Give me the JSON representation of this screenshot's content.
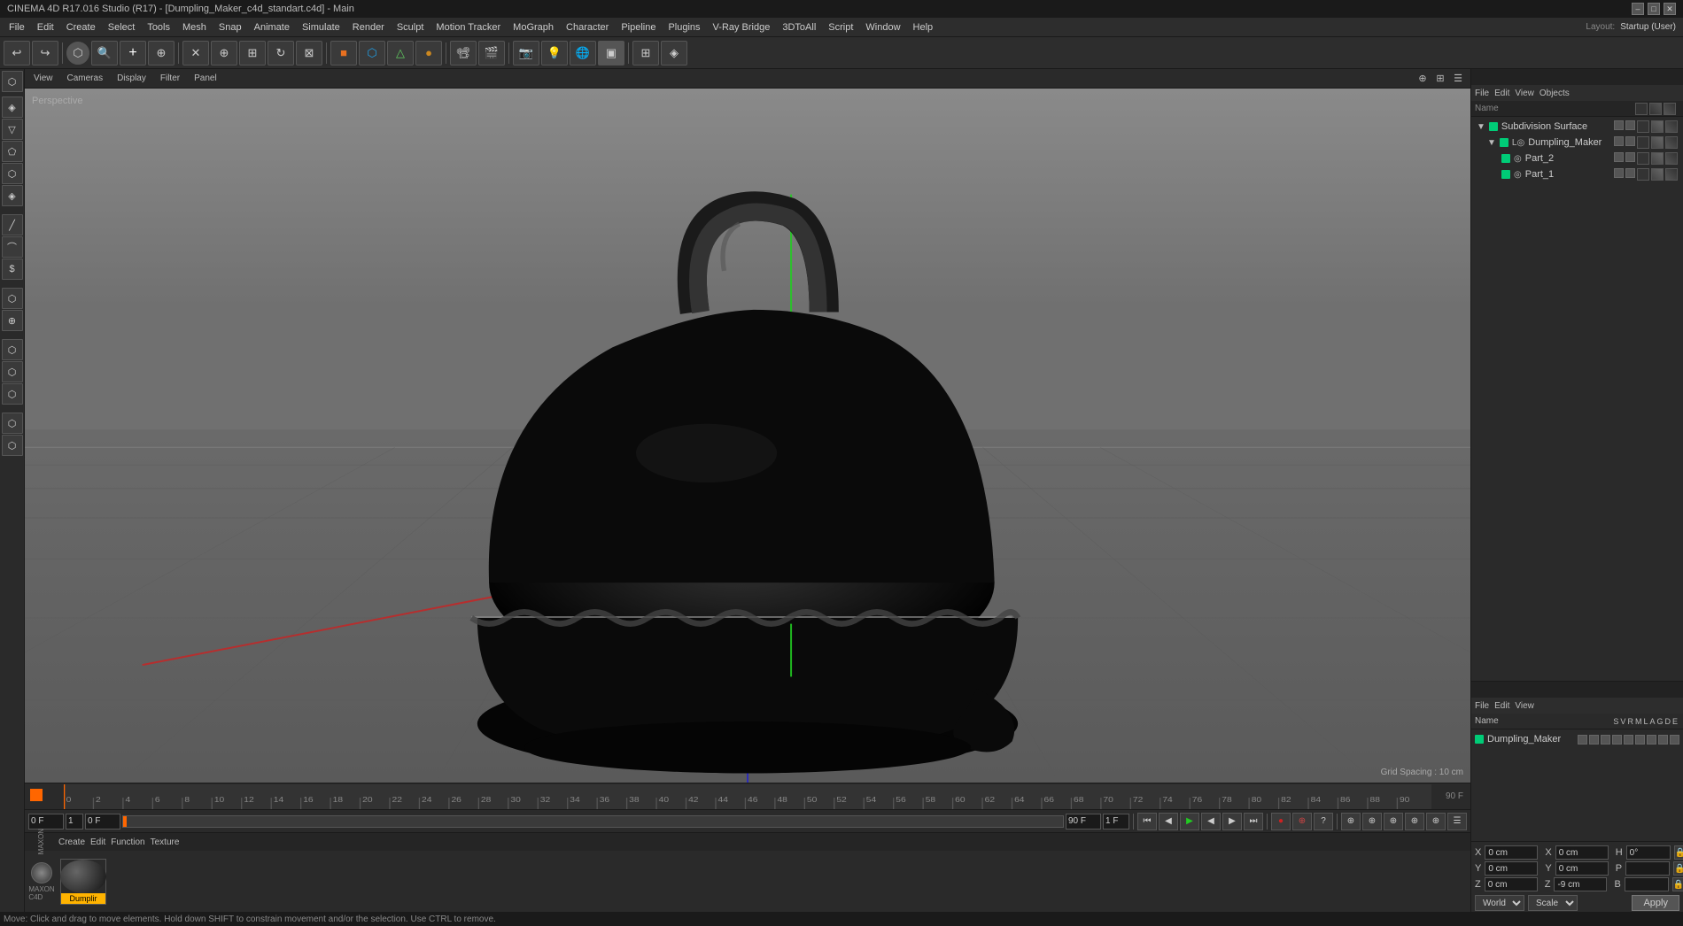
{
  "titlebar": {
    "title": "CINEMA 4D R17.016 Studio (R17) - [Dumpling_Maker_c4d_standart.c4d] - Main",
    "min": "–",
    "max": "□",
    "close": "✕"
  },
  "menubar": {
    "items": [
      "File",
      "Edit",
      "Create",
      "Select",
      "Tools",
      "Mesh",
      "Snap",
      "Animate",
      "Simulate",
      "Render",
      "Sculpt",
      "Motion Tracker",
      "MoGraph",
      "Character",
      "Pipeline",
      "Plugins",
      "V-Ray Bridge",
      "3DToAll",
      "Script",
      "Window",
      "Help"
    ]
  },
  "topright": {
    "layout_label": "Layout:",
    "layout_value": "Startup (User)"
  },
  "viewport": {
    "perspective_label": "Perspective",
    "grid_spacing": "Grid Spacing : 10 cm"
  },
  "viewport_menu": {
    "items": [
      "View",
      "Cameras",
      "Display",
      "Filter",
      "Panel"
    ]
  },
  "obj_manager": {
    "title": "",
    "menus": [
      "File",
      "Edit",
      "View",
      "Objects"
    ],
    "items": [
      {
        "name": "Subdivision Surface",
        "indent": 0,
        "color": "#00cc77"
      },
      {
        "name": "Dumpling_Maker",
        "indent": 1,
        "color": "#00cc77"
      },
      {
        "name": "Part_2",
        "indent": 2,
        "color": "#00cc77"
      },
      {
        "name": "Part_1",
        "indent": 2,
        "color": "#00cc77"
      }
    ]
  },
  "attr_manager": {
    "menus": [
      "File",
      "Edit",
      "View"
    ],
    "col_headers": [
      "Name",
      "S",
      "V",
      "R",
      "M",
      "L",
      "A",
      "G",
      "D",
      "E"
    ],
    "item": {
      "name": "Dumpling_Maker",
      "color": "#00cc77"
    }
  },
  "coordinates": {
    "x_label": "X",
    "x_value": "0 cm",
    "x2_label": "X",
    "x2_value": "0 cm",
    "h_label": "H",
    "h_value": "0°",
    "y_label": "Y",
    "y_value": "0 cm",
    "y2_label": "Y",
    "y2_value": "0 cm",
    "p_label": "P",
    "p_value": "",
    "z_label": "Z",
    "z_value": "0 cm",
    "z2_label": "Z",
    "z2_value": "-9 cm",
    "b_label": "B",
    "b_value": "",
    "world_label": "World",
    "scale_label": "Scale",
    "apply_label": "Apply"
  },
  "material_bar": {
    "menus": [
      "Create",
      "Edit",
      "Function",
      "Texture"
    ],
    "material_name": "Dumplir"
  },
  "timeline": {
    "start_frame": "0 F",
    "end_frame": "90 F",
    "current_frame": "0 F",
    "fps": "1",
    "end_frame2": "1 F",
    "marks": [
      "0",
      "2",
      "4",
      "6",
      "8",
      "10",
      "12",
      "14",
      "16",
      "18",
      "20",
      "22",
      "24",
      "26",
      "28",
      "30",
      "32",
      "34",
      "36",
      "38",
      "40",
      "42",
      "44",
      "46",
      "48",
      "50",
      "52",
      "54",
      "56",
      "58",
      "60",
      "62",
      "64",
      "66",
      "68",
      "70",
      "72",
      "74",
      "76",
      "78",
      "80",
      "82",
      "84",
      "86",
      "88",
      "90"
    ]
  },
  "status_bar": {
    "text": "Move: Click and drag to move elements. Hold down SHIFT to constrain movement and/or the selection. Use CTRL to remove."
  },
  "icons": {
    "undo": "↩",
    "redo": "↪",
    "play": "▶",
    "stop": "■",
    "rewind": "◀◀",
    "forward": "▶▶",
    "frame_back": "◀",
    "frame_fwd": "▶",
    "record": "●"
  }
}
